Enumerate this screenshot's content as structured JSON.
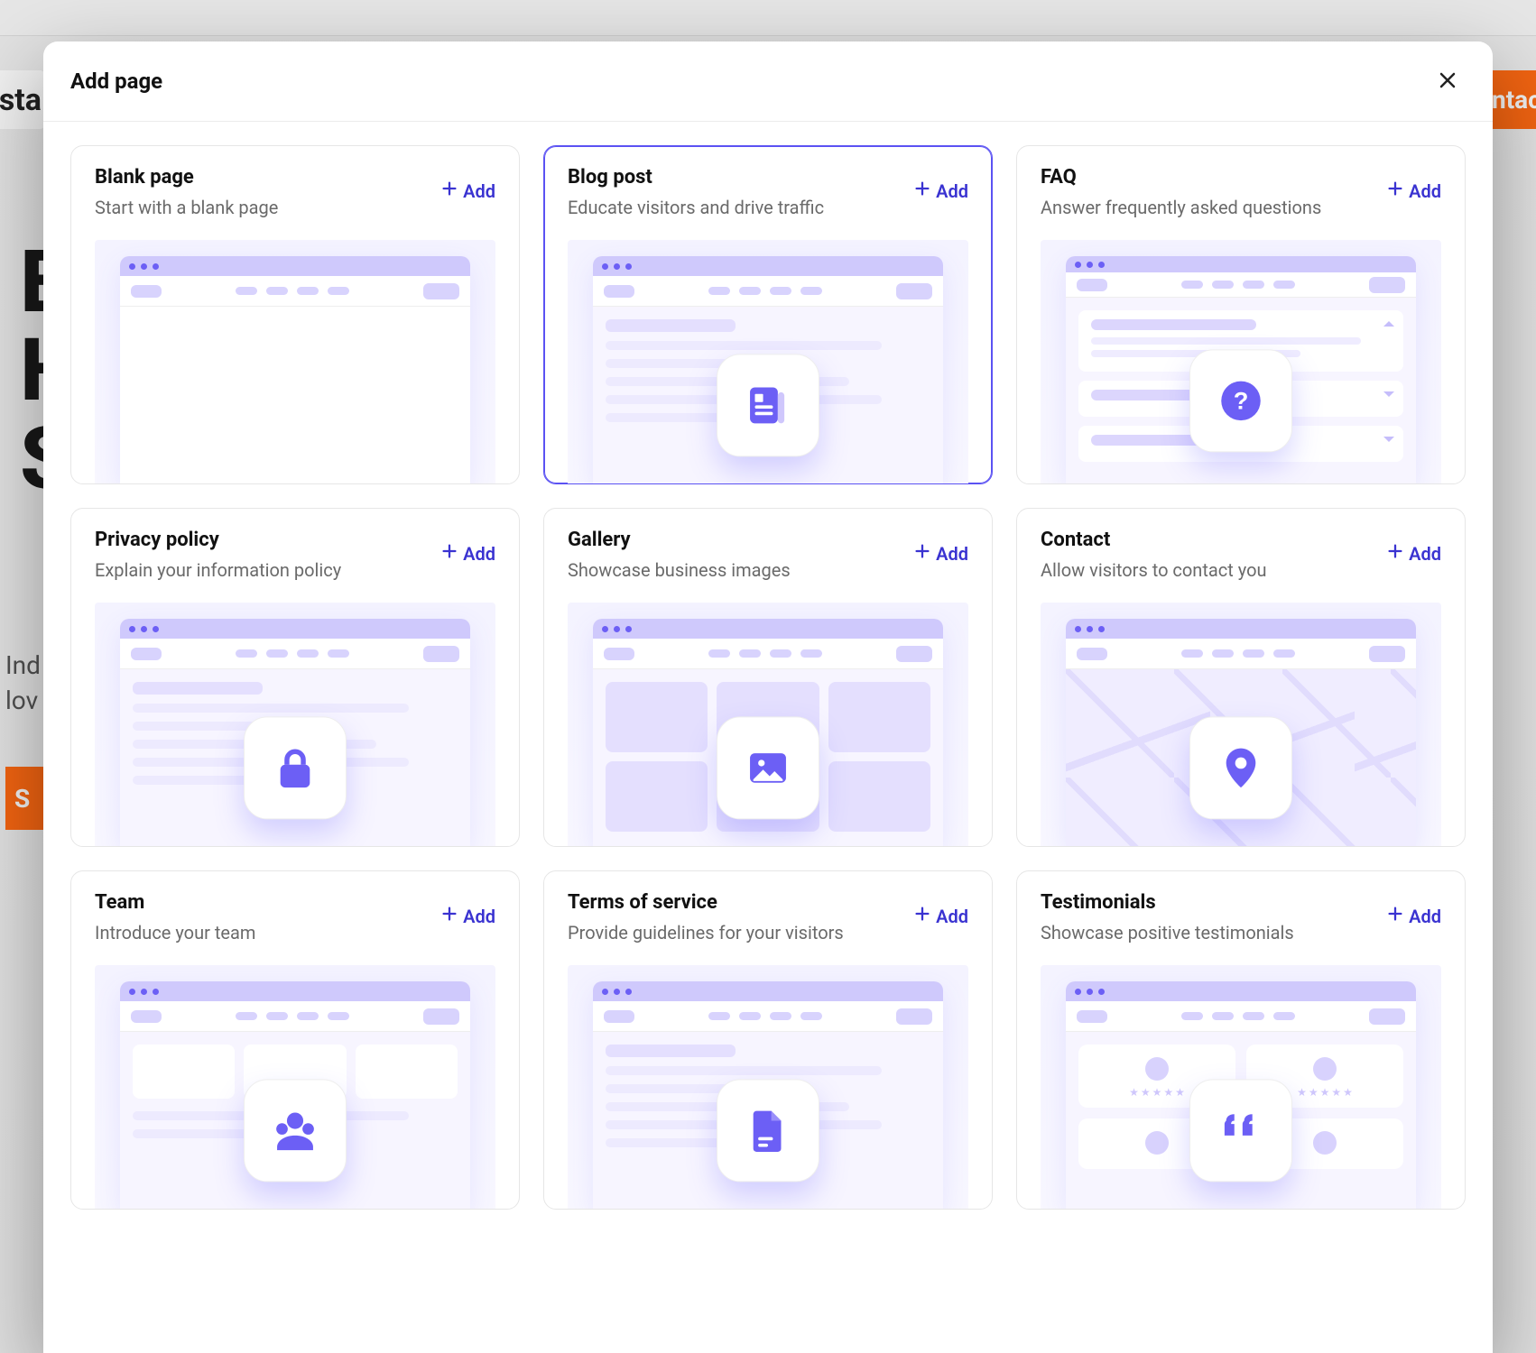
{
  "background": {
    "brand_fragment": "asta",
    "right_tag_fragment": "ntac",
    "hero_line1": "E",
    "hero_line2": "H",
    "hero_line3": "S",
    "sub_line1": "Ind",
    "sub_line2": "lov",
    "cta_fragment": "S"
  },
  "modal": {
    "title": "Add page",
    "add_label": "Add"
  },
  "templates": [
    {
      "title": "Blank page",
      "subtitle": "Start with a blank page",
      "icon": "blank",
      "selected": false
    },
    {
      "title": "Blog post",
      "subtitle": "Educate visitors and drive traffic",
      "icon": "blog",
      "selected": true
    },
    {
      "title": "FAQ",
      "subtitle": "Answer frequently asked questions",
      "icon": "faq",
      "selected": false
    },
    {
      "title": "Privacy policy",
      "subtitle": "Explain your information policy",
      "icon": "lock",
      "selected": false
    },
    {
      "title": "Gallery",
      "subtitle": "Showcase business images",
      "icon": "image",
      "selected": false
    },
    {
      "title": "Contact",
      "subtitle": "Allow visitors to contact you",
      "icon": "pin",
      "selected": false
    },
    {
      "title": "Team",
      "subtitle": "Introduce your team",
      "icon": "team",
      "selected": false
    },
    {
      "title": "Terms of service",
      "subtitle": "Provide guidelines for your visitors",
      "icon": "doc",
      "selected": false
    },
    {
      "title": "Testimonials",
      "subtitle": "Showcase positive testimonials",
      "icon": "quote",
      "selected": false
    }
  ]
}
